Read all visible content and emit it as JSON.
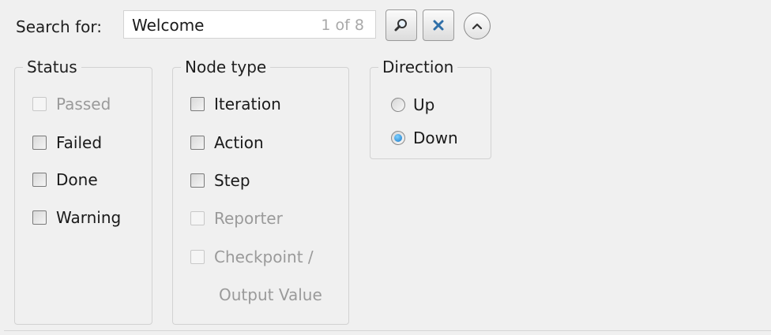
{
  "search": {
    "label": "Search for:",
    "value": "Welcome",
    "count": "1 of 8"
  },
  "toolbar": {
    "search_icon": "magnifier-icon",
    "clear_icon": "close-x-icon",
    "collapse_icon": "chevron-up-icon"
  },
  "status": {
    "legend": "Status",
    "items": [
      {
        "label": "Passed",
        "checked": false,
        "disabled": true
      },
      {
        "label": "Failed",
        "checked": false,
        "disabled": false
      },
      {
        "label": "Done",
        "checked": false,
        "disabled": false
      },
      {
        "label": "Warning",
        "checked": false,
        "disabled": false
      }
    ]
  },
  "node_type": {
    "legend": "Node type",
    "items": [
      {
        "label": "Iteration",
        "checked": false,
        "disabled": false
      },
      {
        "label": "Action",
        "checked": false,
        "disabled": false
      },
      {
        "label": "Step",
        "checked": false,
        "disabled": false
      },
      {
        "label": "Reporter",
        "checked": false,
        "disabled": true
      },
      {
        "label": "Checkpoint /",
        "checked": false,
        "disabled": true
      },
      {
        "label": "Output Value",
        "checked": false,
        "disabled": true
      }
    ]
  },
  "direction": {
    "legend": "Direction",
    "options": [
      {
        "label": "Up",
        "selected": false
      },
      {
        "label": "Down",
        "selected": true
      }
    ]
  },
  "colors": {
    "background": "#f0f0f0",
    "disabled_text": "#9a9a9a",
    "radio_selected": "#1978c8",
    "clear_icon": "#2f6fa8"
  }
}
